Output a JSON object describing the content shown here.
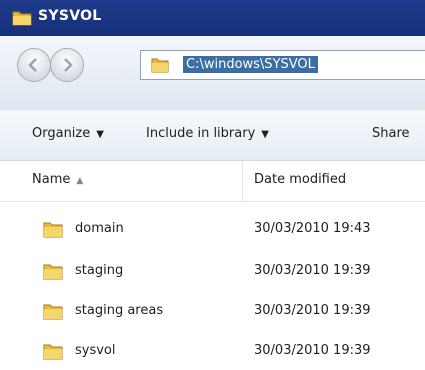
{
  "window": {
    "title": "SYSVOL",
    "icon": "folder-icon"
  },
  "navigation": {
    "back_icon": "arrow-left-icon",
    "forward_icon": "arrow-right-icon"
  },
  "address": {
    "path": "C:\\windows\\SYSVOL",
    "icon": "folder-icon"
  },
  "toolbar": {
    "organize": "Organize",
    "include": "Include in library",
    "share": "Share"
  },
  "columns": {
    "name": "Name",
    "date_modified": "Date modified"
  },
  "files": [
    {
      "name": "domain",
      "date": "30/03/2010 19:43"
    },
    {
      "name": "staging",
      "date": "30/03/2010 19:39"
    },
    {
      "name": "staging areas",
      "date": "30/03/2010 19:39"
    },
    {
      "name": "sysvol",
      "date": "30/03/2010 19:39"
    }
  ],
  "colors": {
    "title_bar": "#16307a",
    "selection": "#3a6ea5",
    "folder": "#e8b93a"
  }
}
